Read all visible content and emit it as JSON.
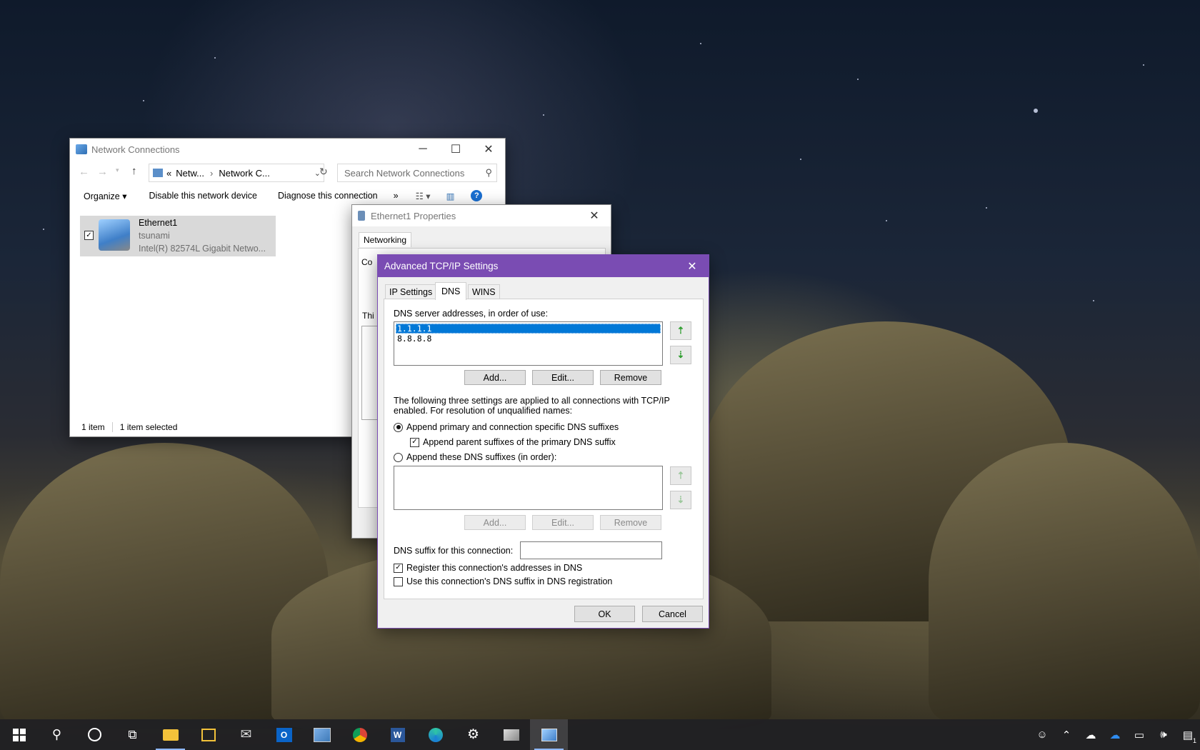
{
  "network_connections": {
    "title": "Network Connections",
    "address": {
      "prefix": "«",
      "part1": "Netw...",
      "part2": "Network C..."
    },
    "search_placeholder": "Search Network Connections",
    "toolbar": {
      "organize": "Organize",
      "disable": "Disable this network device",
      "diagnose": "Diagnose this connection",
      "more": "»"
    },
    "item": {
      "name": "Ethernet1",
      "network": "tsunami",
      "adapter": "Intel(R) 82574L Gigabit Netwo..."
    },
    "status": {
      "count": "1 item",
      "selected": "1 item selected"
    }
  },
  "ethernet_properties": {
    "title": "Ethernet1 Properties",
    "tab": "Networking",
    "partial_label_1": "Co",
    "partial_label_2": "Thi"
  },
  "advanced_tcpip": {
    "title": "Advanced TCP/IP Settings",
    "tabs": [
      "IP Settings",
      "DNS",
      "WINS"
    ],
    "active_tab": "DNS",
    "dns_servers_label": "DNS server addresses, in order of use:",
    "dns_servers": [
      "1.1.1.1",
      "8.8.8.8"
    ],
    "buttons_top": {
      "add": "Add...",
      "edit": "Edit...",
      "remove": "Remove"
    },
    "description": "The following three settings are applied to all connections with TCP/IP enabled. For resolution of unqualified names:",
    "radio_primary": "Append primary and connection specific DNS suffixes",
    "check_parent": "Append parent suffixes of the primary DNS suffix",
    "radio_these": "Append these DNS suffixes (in order):",
    "buttons_bottom": {
      "add": "Add...",
      "edit": "Edit...",
      "remove": "Remove"
    },
    "suffix_label": "DNS suffix for this connection:",
    "suffix_value": "",
    "register_label": "Register this connection's addresses in DNS",
    "use_suffix_label": "Use this connection's DNS suffix in DNS registration",
    "ok": "OK",
    "cancel": "Cancel"
  },
  "colors": {
    "title_accent": "#7a4cb3",
    "selection": "#0078d7"
  },
  "taskbar_icons": [
    "start-icon",
    "search-icon",
    "cortana-icon",
    "task-view-icon",
    "file-explorer-icon",
    "store-icon",
    "mail-icon",
    "outlook-icon",
    "photos-icon",
    "chrome-icon",
    "word-icon",
    "edge-beta-icon",
    "settings-icon",
    "network-adapter-icon",
    "control-panel-icon"
  ],
  "tray": {
    "notification_count": "1"
  }
}
